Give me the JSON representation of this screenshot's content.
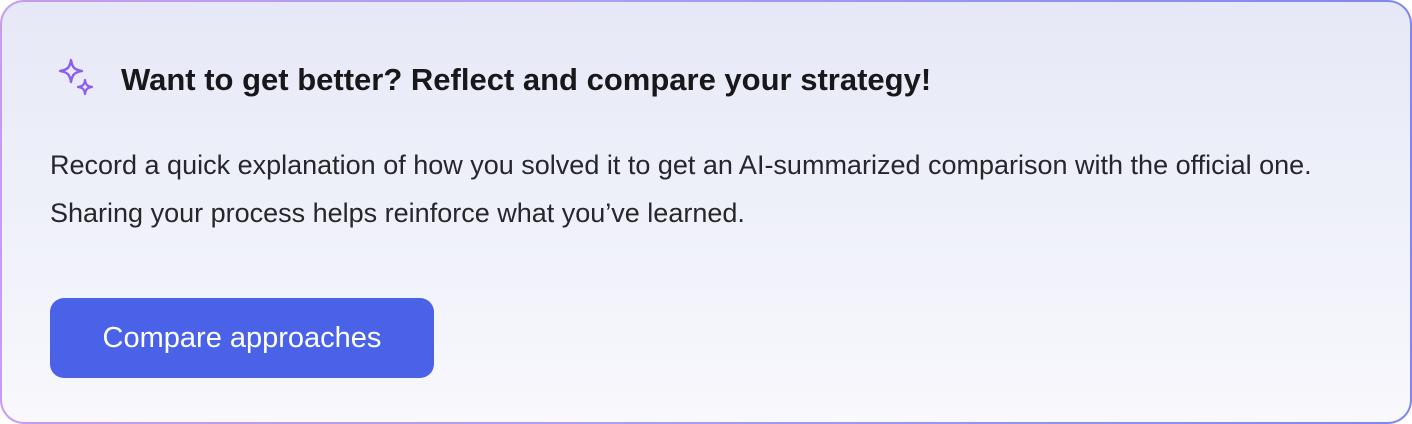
{
  "card": {
    "icon": "sparkles-icon",
    "title": "Want to get better? Reflect and compare your strategy!",
    "description": "Record a quick explanation of how you solved it to get an AI-summarized comparison with the official one. Sharing your process helps reinforce what you’ve learned.",
    "cta_label": "Compare approaches"
  },
  "colors": {
    "accent_button": "#4a62e8",
    "icon": "#8e5df0",
    "title_text": "#18181b",
    "body_text": "#26262b",
    "border_gradient": [
      "#c69bf3",
      "#7f87ef"
    ],
    "background_gradient": [
      "#e6e8f7",
      "#f8f8fd"
    ]
  }
}
